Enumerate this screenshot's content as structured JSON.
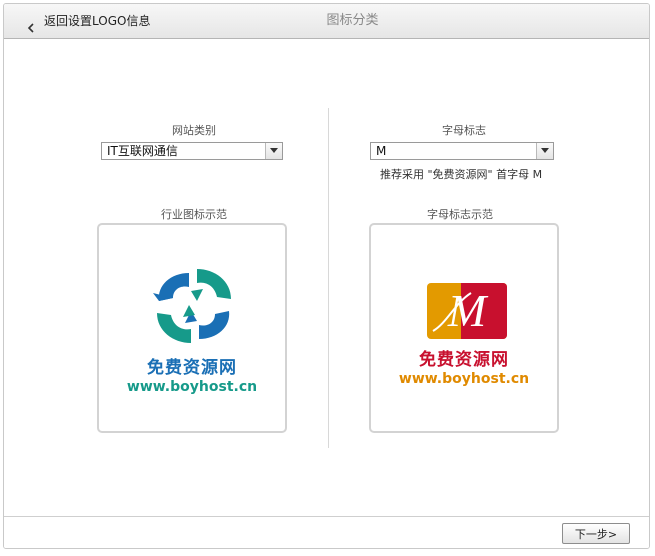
{
  "header": {
    "back_label": "返回设置LOGO信息",
    "title": "图标分类"
  },
  "left": {
    "label": "网站类别",
    "select_value": "IT互联网通信",
    "preview_label": "行业图标示范",
    "preview": {
      "name_text": "免费资源网",
      "url_text": "www.boyhost.cn",
      "name_color": "#1a6fb5",
      "url_color": "#169a8a"
    }
  },
  "right": {
    "label": "字母标志",
    "select_value": "M",
    "hint": "推荐采用 \"免费资源网\" 首字母 M",
    "preview_label": "字母标志示范",
    "preview": {
      "letter": "M",
      "name_text": "免费资源网",
      "url_text": "www.boyhost.cn",
      "name_color": "#c8102e",
      "url_color": "#e08a00"
    }
  },
  "footer": {
    "next_label": "下一步>"
  }
}
